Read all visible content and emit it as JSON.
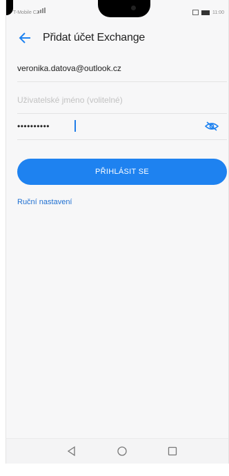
{
  "status": {
    "carrier": "T-Mobile CZ",
    "time": "11:00"
  },
  "app_bar": {
    "title": "Přidat účet Exchange"
  },
  "form": {
    "email_value": "veronika.datova@outlook.cz",
    "username_placeholder": "Uživatelské jméno (volitelné)",
    "password_masked": "••••••••••"
  },
  "login_button_label": "PŘIHLÁSIT SE",
  "manual_setup_label": "Ruční nastavení",
  "colors": {
    "accent": "#1e82f0",
    "link": "#1e6fd1"
  },
  "icons": {
    "back": "back-arrow-icon",
    "visibility": "eye-off-icon",
    "nav_back": "triangle-back-icon",
    "nav_home": "circle-home-icon",
    "nav_recent": "square-recent-icon"
  }
}
